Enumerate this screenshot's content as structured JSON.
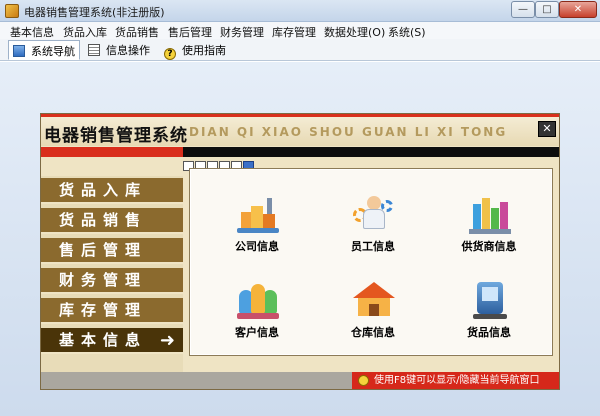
{
  "window": {
    "title": "电器销售管理系统(非注册版)",
    "minimize": "—",
    "maximize": "□",
    "close": "✕"
  },
  "menu": [
    "基本信息",
    "货品入库",
    "货品销售",
    "售后管理",
    "财务管理",
    "库存管理",
    "数据处理(O)",
    "系统(S)"
  ],
  "tabs": [
    {
      "label": "系统导航",
      "icon": "navigation-icon"
    },
    {
      "label": "信息操作",
      "icon": "document-icon"
    },
    {
      "label": "使用指南",
      "icon": "help-icon"
    }
  ],
  "panel": {
    "title": "电器销售管理系统",
    "subtitle": "DIAN QI XIAO SHOU GUAN LI XI TONG",
    "close": "✕",
    "progress": {
      "total": 6,
      "active_index": 5
    }
  },
  "sidebar": {
    "items": [
      "货品入库",
      "货品销售",
      "售后管理",
      "财务管理",
      "库存管理",
      "基本信息"
    ],
    "active": "基本信息",
    "active_arrow": "➜"
  },
  "modules": [
    {
      "label": "公司信息",
      "icon": "company-building-icon"
    },
    {
      "label": "员工信息",
      "icon": "staff-person-icon"
    },
    {
      "label": "供货商信息",
      "icon": "supplier-icon"
    },
    {
      "label": "客户信息",
      "icon": "customers-group-icon"
    },
    {
      "label": "仓库信息",
      "icon": "warehouse-icon"
    },
    {
      "label": "货品信息",
      "icon": "goods-product-icon"
    }
  ],
  "footer": {
    "hint": "使用F8键可以显示/隐藏当前导航窗口"
  },
  "colors": {
    "accent_red": "#d92e1c",
    "sidebar_brown": "#8b6a2e",
    "sidebar_active": "#4a3409",
    "panel_bg": "#efe4c4"
  }
}
